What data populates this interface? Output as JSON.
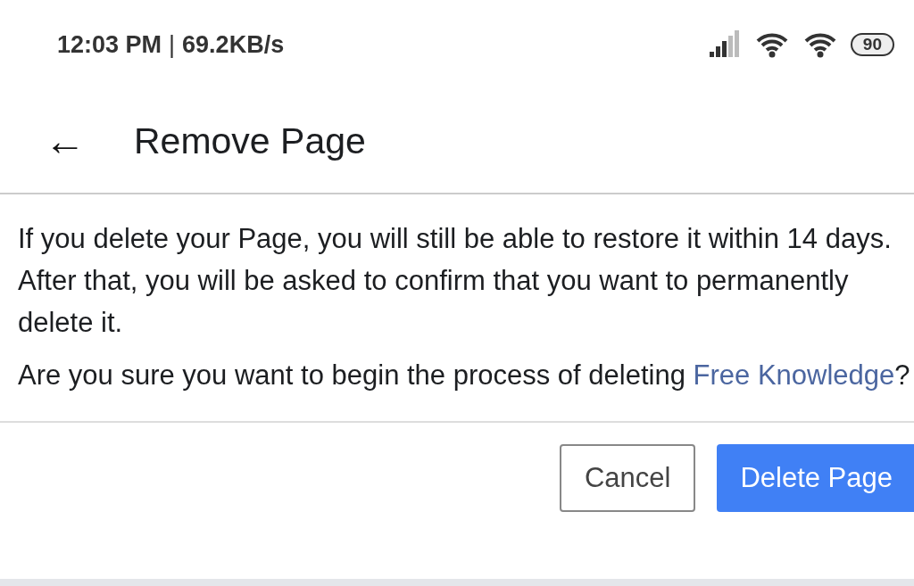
{
  "status_bar": {
    "time": "12:03 PM",
    "separator": "|",
    "speed": "69.2KB/s",
    "battery": "90"
  },
  "header": {
    "back": "←",
    "title": "Remove Page"
  },
  "body": {
    "paragraph": "If you delete your Page, you will still be able to restore it within 14 days. After that, you will be asked to confirm that you want to permanently delete it.",
    "question_prefix": "Are you sure you want to begin the process of deleting ",
    "question_link": "Free Knowledge",
    "question_suffix": "?"
  },
  "buttons": [
    {
      "label": "Cancel",
      "kind": "secondary"
    },
    {
      "label": "Delete Page",
      "kind": "primary"
    }
  ]
}
